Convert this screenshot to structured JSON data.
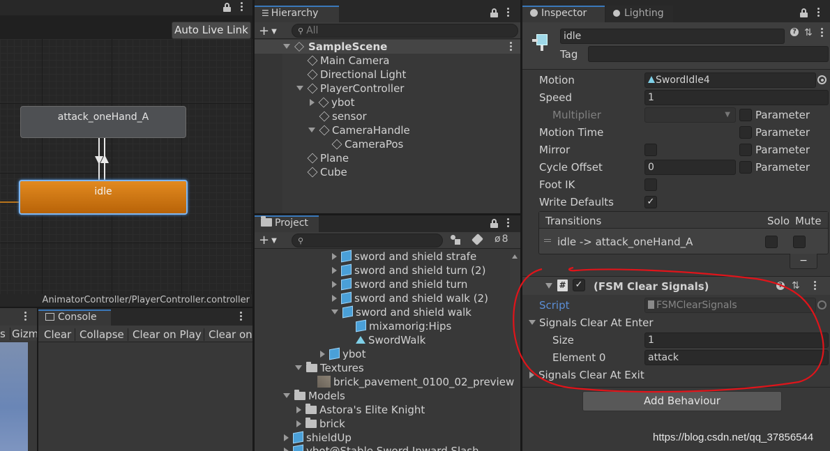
{
  "animator": {
    "auto_live_link": "Auto Live Link",
    "state_attack": "attack_oneHand_A",
    "state_idle": "idle",
    "footer_path": "AnimatorController/PlayerController.controller"
  },
  "scene_strip": {
    "tab_left": "s",
    "gizmos": "Gizm"
  },
  "console": {
    "tab": "Console",
    "buttons": [
      "Clear",
      "Collapse",
      "Clear on Play",
      "Clear on"
    ]
  },
  "hierarchy": {
    "tab": "Hierarchy",
    "search_placeholder": "All",
    "scene": "SampleScene",
    "items": [
      {
        "label": "Main Camera"
      },
      {
        "label": "Directional Light"
      },
      {
        "label": "PlayerController"
      },
      {
        "label": "ybot"
      },
      {
        "label": "sensor"
      },
      {
        "label": "CameraHandle"
      },
      {
        "label": "CameraPos"
      },
      {
        "label": "Plane"
      },
      {
        "label": "Cube"
      }
    ]
  },
  "project": {
    "tab": "Project",
    "hidden_count": "8",
    "items": [
      {
        "label": "sword and shield strafe"
      },
      {
        "label": "sword and shield turn (2)"
      },
      {
        "label": "sword and shield turn"
      },
      {
        "label": "sword and shield walk (2)"
      },
      {
        "label": "sword and shield walk"
      },
      {
        "label": "mixamorig:Hips"
      },
      {
        "label": "SwordWalk"
      },
      {
        "label": "ybot"
      },
      {
        "label": "Textures"
      },
      {
        "label": "brick_pavement_0100_02_preview"
      },
      {
        "label": "Models"
      },
      {
        "label": "Astora's Elite Knight"
      },
      {
        "label": "brick"
      },
      {
        "label": "shieldUp"
      },
      {
        "label": "ybot@Stable Sword Inward Slash"
      }
    ]
  },
  "inspector": {
    "tab": "Inspector",
    "tab_lighting": "Lighting",
    "object_name": "idle",
    "tag_label": "Tag",
    "tag_value": "",
    "motion_label": "Motion",
    "motion_value": "SwordIdle4",
    "speed_label": "Speed",
    "speed_value": "1",
    "multiplier_label": "Multiplier",
    "parameter_label": "Parameter",
    "motion_time_label": "Motion Time",
    "mirror_label": "Mirror",
    "cycle_offset_label": "Cycle Offset",
    "cycle_offset_value": "0",
    "foot_ik_label": "Foot IK",
    "write_defaults_label": "Write Defaults",
    "transitions_label": "Transitions",
    "solo_label": "Solo",
    "mute_label": "Mute",
    "transition_item": "idle -> attack_oneHand_A",
    "minus": "−",
    "component_title": "(FSM Clear Signals)",
    "script_label": "Script",
    "script_value": "FSMClearSignals",
    "signals_enter_label": "Signals Clear At Enter",
    "size_label": "Size",
    "size_value": "1",
    "element0_label": "Element 0",
    "element0_value": "attack",
    "signals_exit_label": "Signals Clear At Exit",
    "add_behaviour": "Add Behaviour"
  },
  "watermark": "https://blog.csdn.net/qq_37856544",
  "colors": {
    "accent_blue": "#3a79bb",
    "idle_orange": "#c86f10",
    "annotation_red": "#e0141a"
  }
}
